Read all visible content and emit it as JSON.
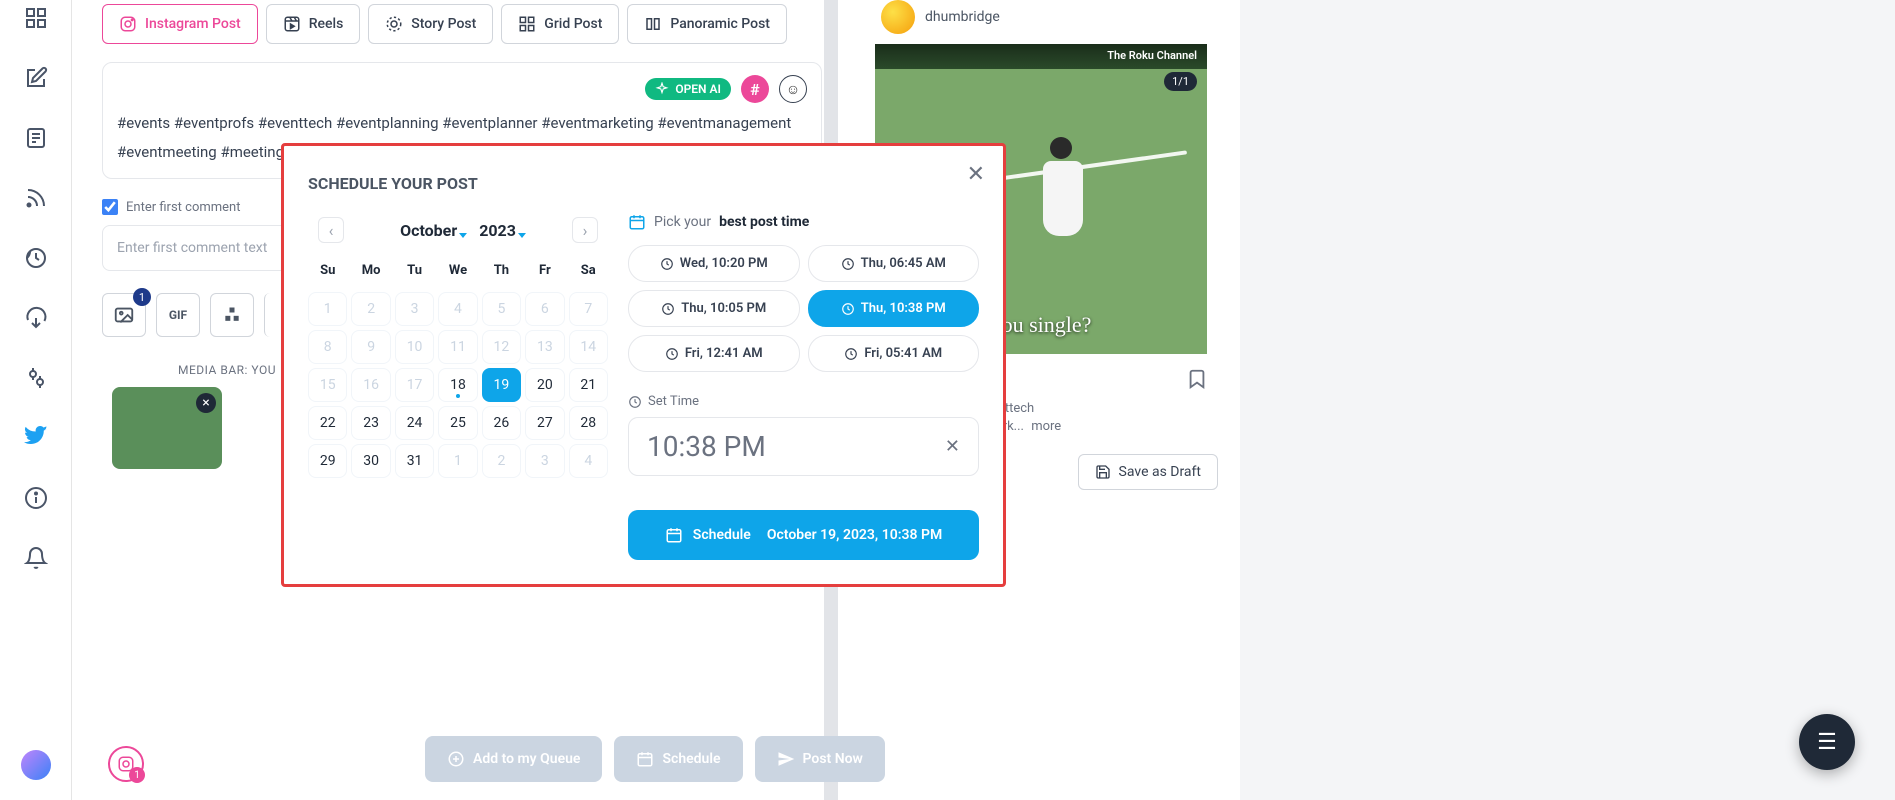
{
  "sidebar": {
    "avatar": true
  },
  "tabs": {
    "instagram_post": "Instagram Post",
    "reels": "Reels",
    "story_post": "Story Post",
    "grid_post": "Grid Post",
    "panoramic_post": "Panoramic Post"
  },
  "composer": {
    "openai_label": "OPEN AI",
    "text": "#events #eventprofs #eventtech #eventplanning #eventplanner #eventmarketing #eventmanagement #eventmeeting #meetingprofs #eventtechtalk #VR #AR #mixedreality #socialwall #livestream",
    "first_comment_label": "Enter first comment",
    "first_comment_placeholder": "Enter first comment text",
    "gif_label": "GIF",
    "media_bar_label": "MEDIA BAR: YOU",
    "media_count": "1"
  },
  "actions": {
    "add_queue": "Add to my Queue",
    "schedule": "Schedule",
    "post_now": "Post Now",
    "ig_badge": "1"
  },
  "preview": {
    "username": "dhumbridge",
    "overlay_stamp": "The Roku Channel",
    "count": "1/1",
    "overlay_text": "you single?",
    "caption_line1": "s #eventprofs #eventtech",
    "caption_line2": "ntplanner #eventmark...",
    "more_label": "more",
    "save_draft": "Save as Draft"
  },
  "modal": {
    "title": "SCHEDULE YOUR POST",
    "month": "October",
    "year": "2023",
    "dow": [
      "Su",
      "Mo",
      "Tu",
      "We",
      "Th",
      "Fr",
      "Sa"
    ],
    "days": [
      {
        "n": "1",
        "muted": true
      },
      {
        "n": "2",
        "muted": true
      },
      {
        "n": "3",
        "muted": true
      },
      {
        "n": "4",
        "muted": true
      },
      {
        "n": "5",
        "muted": true
      },
      {
        "n": "6",
        "muted": true
      },
      {
        "n": "7",
        "muted": true
      },
      {
        "n": "8",
        "muted": true
      },
      {
        "n": "9",
        "muted": true
      },
      {
        "n": "10",
        "muted": true
      },
      {
        "n": "11",
        "muted": true
      },
      {
        "n": "12",
        "muted": true
      },
      {
        "n": "13",
        "muted": true
      },
      {
        "n": "14",
        "muted": true
      },
      {
        "n": "15",
        "muted": true
      },
      {
        "n": "16",
        "muted": true
      },
      {
        "n": "17",
        "muted": true
      },
      {
        "n": "18",
        "dot": true
      },
      {
        "n": "19",
        "selected": true
      },
      {
        "n": "20"
      },
      {
        "n": "21"
      },
      {
        "n": "22"
      },
      {
        "n": "23"
      },
      {
        "n": "24"
      },
      {
        "n": "25"
      },
      {
        "n": "26"
      },
      {
        "n": "27"
      },
      {
        "n": "28"
      },
      {
        "n": "29"
      },
      {
        "n": "30"
      },
      {
        "n": "31"
      },
      {
        "n": "1",
        "muted": true
      },
      {
        "n": "2",
        "muted": true
      },
      {
        "n": "3",
        "muted": true
      },
      {
        "n": "4",
        "muted": true
      }
    ],
    "pick_prefix": "Pick your",
    "pick_bold": "best post time",
    "times": [
      {
        "label": "Wed, 10:20 PM"
      },
      {
        "label": "Thu, 06:45 AM"
      },
      {
        "label": "Thu, 10:05 PM"
      },
      {
        "label": "Thu, 10:38 PM",
        "active": true
      },
      {
        "label": "Fri, 12:41 AM"
      },
      {
        "label": "Fri, 05:41 AM"
      }
    ],
    "set_time_label": "Set Time",
    "time_value": "10:38 PM",
    "schedule_label": "Schedule",
    "schedule_date": "October 19, 2023, 10:38 PM"
  }
}
